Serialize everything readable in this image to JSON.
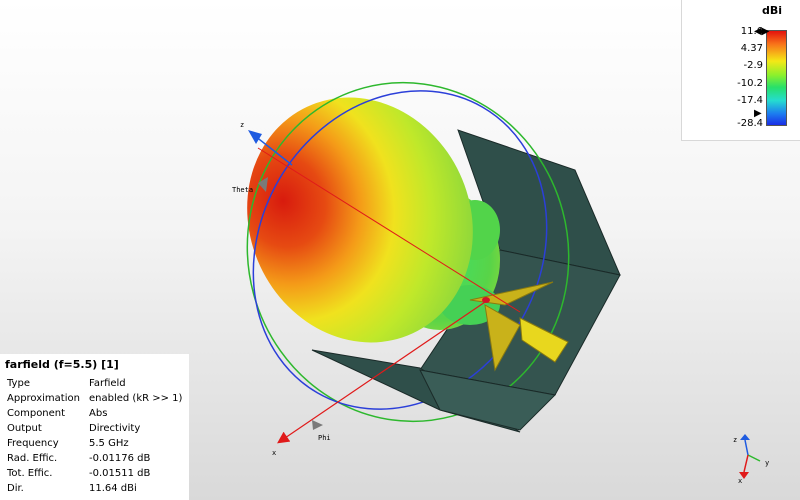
{
  "colorbar": {
    "unit": "dBi",
    "ticks": [
      "11.6",
      "4.37",
      "-2.9",
      "-10.2",
      "-17.4",
      "-28.4"
    ]
  },
  "info": {
    "title": "farfield (f=5.5) [1]",
    "rows": [
      {
        "key": "Type",
        "value": "Farfield"
      },
      {
        "key": "Approximation",
        "value": "enabled (kR >> 1)"
      },
      {
        "key": "Component",
        "value": "Abs"
      },
      {
        "key": "Output",
        "value": "Directivity"
      },
      {
        "key": "Frequency",
        "value": "5.5 GHz"
      },
      {
        "key": "Rad. Effic.",
        "value": "-0.01176 dB"
      },
      {
        "key": "Tot. Effic.",
        "value": "-0.01511 dB"
      },
      {
        "key": "Dir.",
        "value": "11.64 dBi"
      }
    ]
  },
  "axes": {
    "z": "z",
    "x": "x",
    "theta": "Theta",
    "phi": "Phi"
  },
  "triad": {
    "z": "z",
    "x": "x",
    "y": "y"
  },
  "colors": {
    "phi_circle": "#2db82d",
    "theta_circle": "#2b3fd9",
    "x_axis": "#e01a1a",
    "z_axis": "#1f5be0",
    "reflector": "#2f4f4a"
  }
}
